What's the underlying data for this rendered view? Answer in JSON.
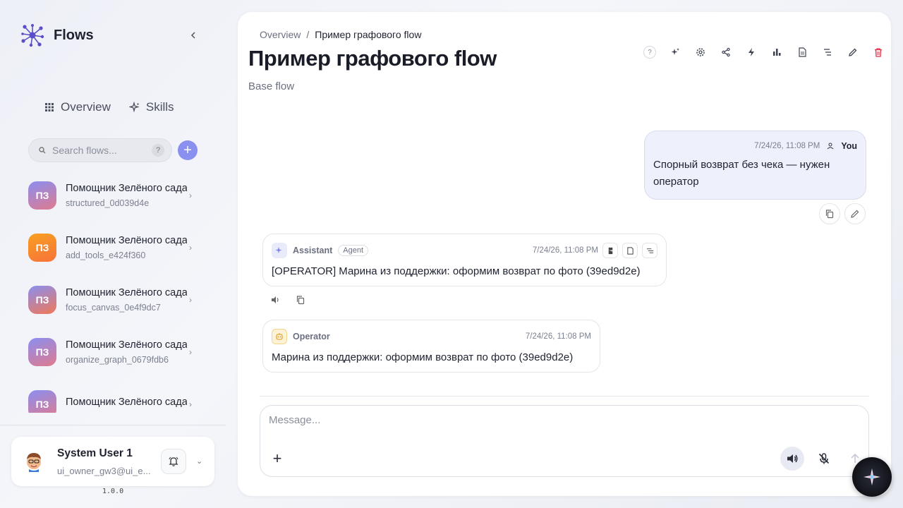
{
  "app": {
    "name": "Flows",
    "version": "1.0.0"
  },
  "nav": {
    "overview": "Overview",
    "skills": "Skills"
  },
  "search": {
    "placeholder": "Search flows...",
    "help": "?"
  },
  "flows": [
    {
      "initials": "ПЗ",
      "title": "Помощник Зелёного сада",
      "subtitle": "structured_0d039d4e",
      "color_from": "#8a8ff0",
      "color_to": "#e07a8f"
    },
    {
      "initials": "ПЗ",
      "title": "Помощник Зелёного сада",
      "subtitle": "add_tools_e424f360",
      "color_from": "#f7a020",
      "color_to": "#f7723a"
    },
    {
      "initials": "ПЗ",
      "title": "Помощник Зелёного сада",
      "subtitle": "focus_canvas_0e4f9dc7",
      "color_from": "#8a8ff0",
      "color_to": "#f07858"
    },
    {
      "initials": "ПЗ",
      "title": "Помощник Зелёного сада",
      "subtitle": "organize_graph_0679fdb6",
      "color_from": "#8a8ff0",
      "color_to": "#e07a8f"
    },
    {
      "initials": "ПЗ",
      "title": "Помощник Зелёного сада",
      "subtitle": "",
      "color_from": "#8a8ff0",
      "color_to": "#e07a8f"
    }
  ],
  "user": {
    "name": "System User 1",
    "email": "ui_owner_gw3@ui_e..."
  },
  "breadcrumb": {
    "root": "Overview",
    "separator": "/",
    "current": "Пример графового flow"
  },
  "page": {
    "title": "Пример графового flow",
    "subtitle": "Base flow"
  },
  "toolbar": {
    "help": "?"
  },
  "messages": {
    "user": {
      "time": "7/24/26, 11:08 PM",
      "author": "You",
      "text": "Спорный возврат без чека — нужен оператор"
    },
    "assistant": {
      "author": "Assistant",
      "badge": "Agent",
      "time": "7/24/26, 11:08 PM",
      "text": "[OPERATOR] Марина из поддержки: оформим возврат по фото (39ed9d2e)"
    },
    "operator": {
      "author": "Operator",
      "time": "7/24/26, 11:08 PM",
      "text": "Марина из поддержки: оформим возврат по фото (39ed9d2e)"
    }
  },
  "composer": {
    "placeholder": "Message...",
    "plus": "+"
  },
  "colors": {
    "accent": "#8a90f0",
    "danger": "#e0334a",
    "user_bubble": "#eef0fb"
  }
}
